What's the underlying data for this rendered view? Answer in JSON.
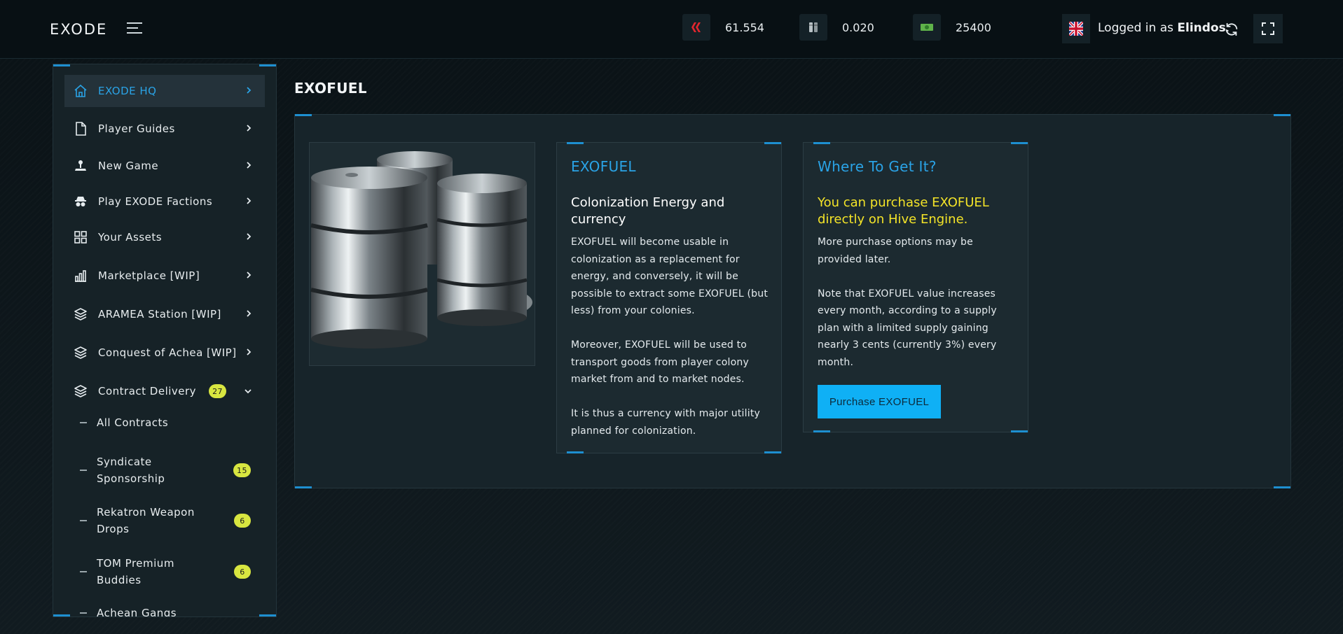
{
  "header": {
    "logo": "EXODE",
    "currencies": [
      {
        "icon": "hive-icon",
        "value": "61.554"
      },
      {
        "icon": "exofuel-icon",
        "value": "0.020"
      },
      {
        "icon": "cash-icon",
        "value": "25400"
      }
    ],
    "logged_prefix": "Logged in as ",
    "username": "Elindos",
    "logged_suffix": "."
  },
  "sidebar": {
    "items": [
      {
        "label": "EXODE HQ",
        "icon": "home-icon",
        "active": true
      },
      {
        "label": "Player Guides",
        "icon": "document-icon"
      },
      {
        "label": "New Game",
        "icon": "joystick-icon"
      },
      {
        "label": "Play EXODE Factions",
        "icon": "spy-icon"
      },
      {
        "label": "Your Assets",
        "icon": "grid-icon"
      },
      {
        "label": "Marketplace [WIP]",
        "icon": "chart-icon"
      },
      {
        "label": "ARAMEA Station [WIP]",
        "icon": "layers-icon"
      },
      {
        "label": "Conquest of Achea [WIP]",
        "icon": "layers-icon"
      },
      {
        "label": "Contract Delivery",
        "icon": "layers-icon",
        "badge": "27",
        "expanded": true
      }
    ],
    "sub_items": [
      {
        "label": "All Contracts"
      },
      {
        "label": "Syndicate Sponsorship",
        "badge": "15"
      },
      {
        "label": "Rekatron Weapon Drops",
        "badge": "6"
      },
      {
        "label": "TOM Premium Buddies",
        "badge": "6"
      },
      {
        "label": "Achean Gangs"
      }
    ]
  },
  "main": {
    "title": "EXOFUEL",
    "info_card": {
      "title": "EXOFUEL",
      "subtitle": "Colonization Energy and currency",
      "paragraphs": [
        "EXOFUEL will become usable in colonization as a replacement for energy, and conversely, it will be possible to extract some EXOFUEL (but less) from your colonies.",
        "Moreover, EXOFUEL will be used to transport goods from player colony market from and to market nodes.",
        "It is thus a currency with major utility planned for colonization."
      ]
    },
    "where_card": {
      "title": "Where To Get It?",
      "highlight": "You can purchase EXOFUEL directly on Hive Engine.",
      "paragraphs": [
        "More purchase options may be provided later.",
        "Note that EXOFUEL value increases every month, according to a supply plan with a limited supply gaining nearly 3 cents (currently 3%) every month."
      ],
      "button_label": "Purchase EXOFUEL"
    }
  },
  "colors": {
    "accent": "#2aa3e6",
    "highlight": "#f4e428",
    "badge": "#d8e640",
    "button": "#0fb0f5"
  }
}
